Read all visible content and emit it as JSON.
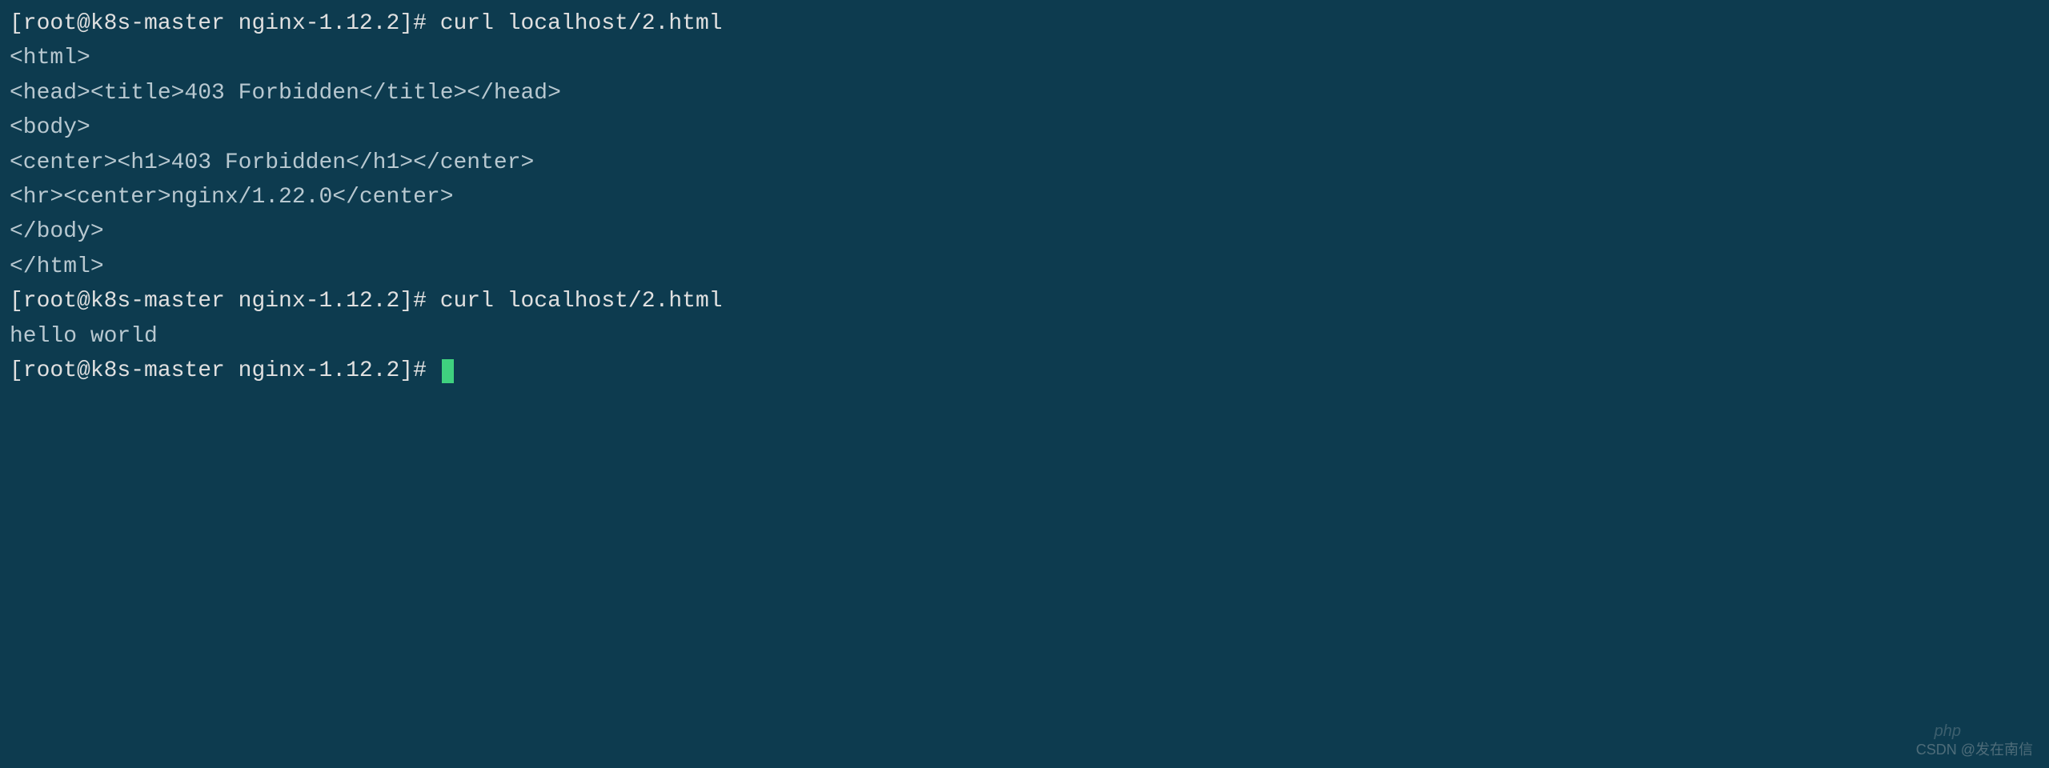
{
  "terminal": {
    "lines": [
      {
        "type": "prompt",
        "text": "[root@k8s-master nginx-1.12.2]# curl localhost/2.html"
      },
      {
        "type": "output",
        "text": "<html>"
      },
      {
        "type": "output",
        "text": "<head><title>403 Forbidden</title></head>"
      },
      {
        "type": "output",
        "text": "<body>"
      },
      {
        "type": "output",
        "text": "<center><h1>403 Forbidden</h1></center>"
      },
      {
        "type": "output",
        "text": "<hr><center>nginx/1.22.0</center>"
      },
      {
        "type": "output",
        "text": "</body>"
      },
      {
        "type": "output",
        "text": "</html>"
      },
      {
        "type": "prompt",
        "text": "[root@k8s-master nginx-1.12.2]# curl localhost/2.html"
      },
      {
        "type": "output",
        "text": "hello world"
      },
      {
        "type": "prompt-cursor",
        "text": "[root@k8s-master nginx-1.12.2]# "
      }
    ]
  },
  "watermark": {
    "text": "CSDN @发在南信",
    "icon": "php"
  },
  "colors": {
    "background": "#0d3b4f",
    "foreground": "#e0e0e0",
    "output": "#b8c8d0",
    "cursor": "#3fd17f"
  }
}
